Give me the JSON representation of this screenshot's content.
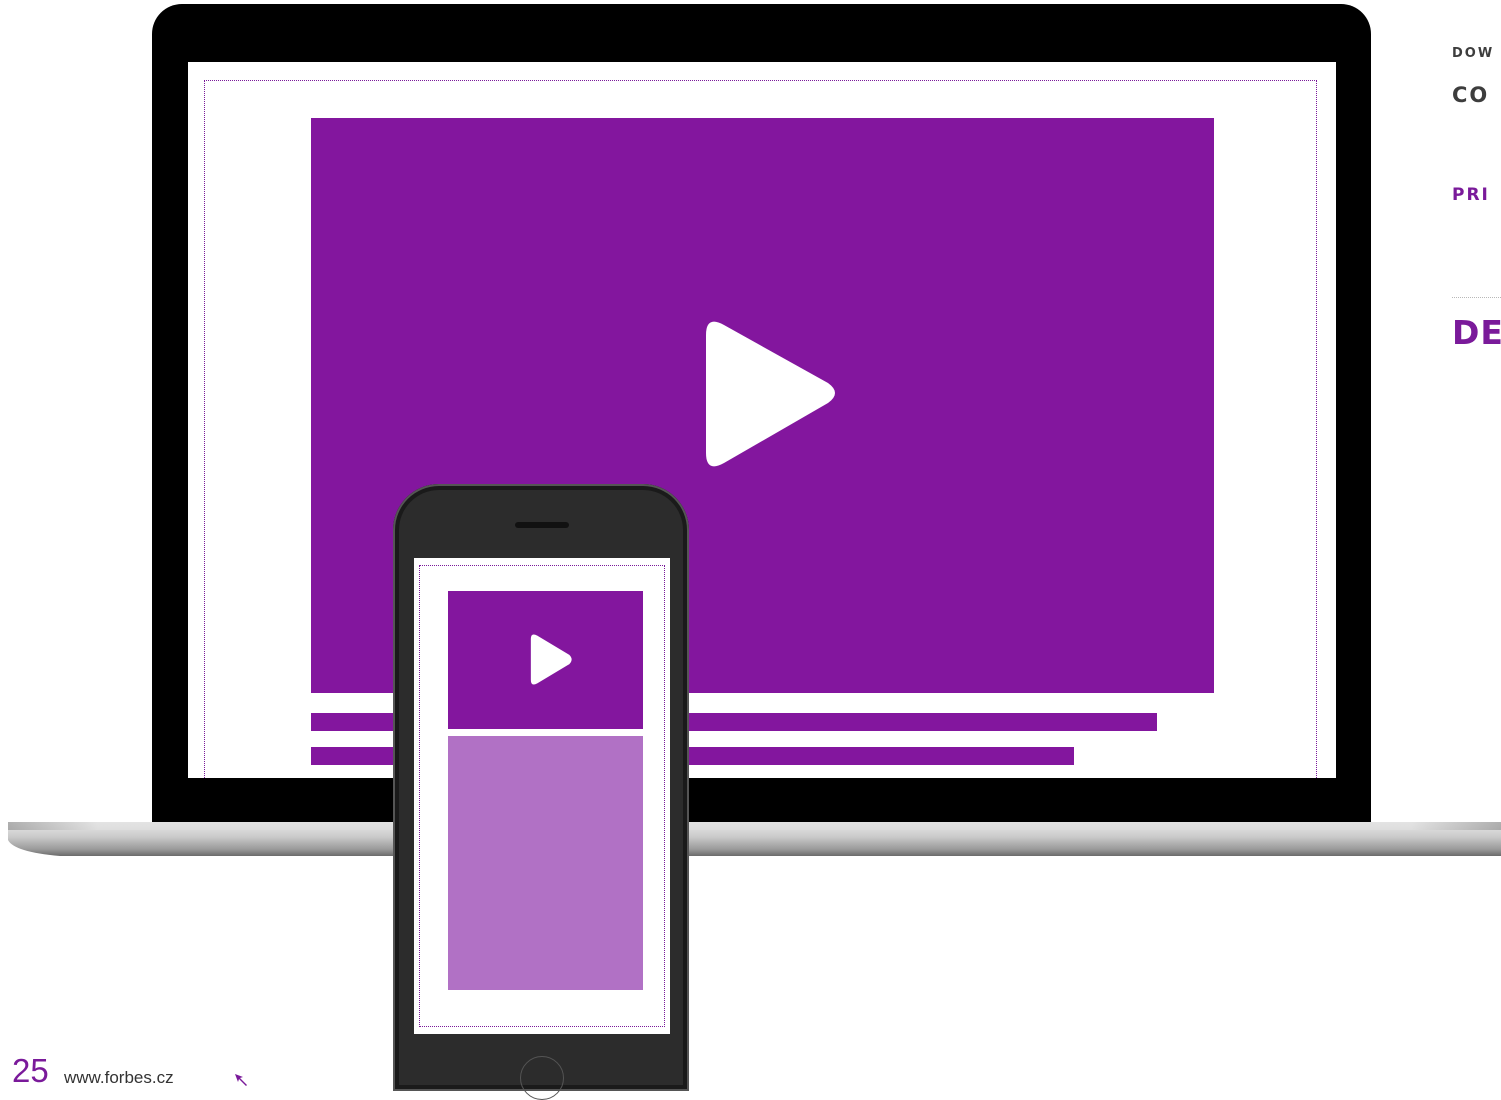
{
  "colors": {
    "accent": "#83169e",
    "accent_light": "#b171c5",
    "text_dark": "#3d3d3d"
  },
  "side_text": {
    "line1": "DOW",
    "line2": "CO",
    "line3": "PRI",
    "line4": "DE"
  },
  "footer": {
    "page_number": "25",
    "url": "www.forbes.cz"
  },
  "icons": {
    "laptop_play": "play-icon",
    "phone_play": "play-icon",
    "footer_arrow": "arrow-icon"
  }
}
